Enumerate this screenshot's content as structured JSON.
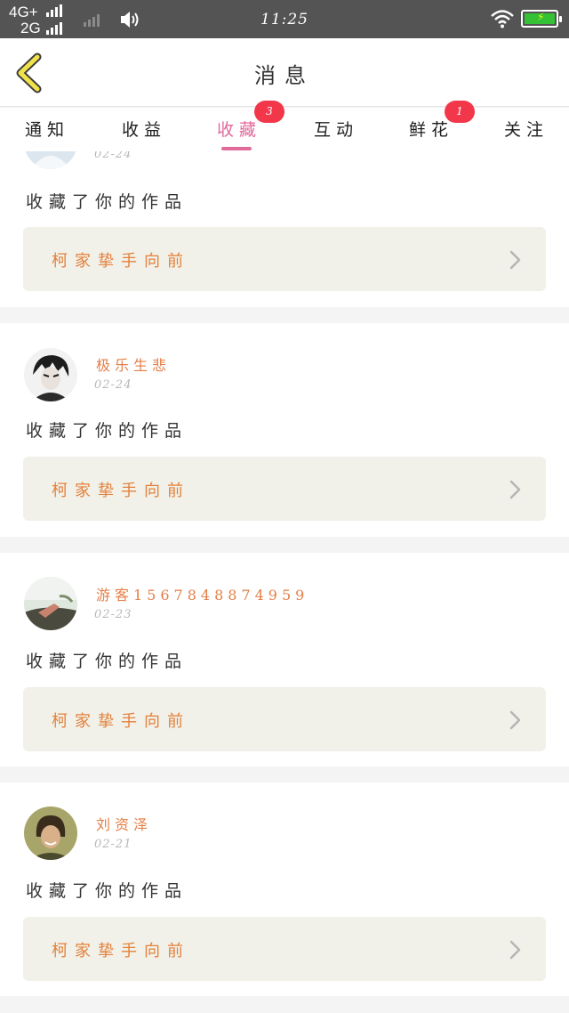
{
  "status_bar": {
    "network_top": "4G+",
    "network_bottom": "2G",
    "time": "11:25"
  },
  "header": {
    "title": "消息",
    "back_icon": "chevron-left-icon"
  },
  "tabs": [
    {
      "label": "通知",
      "badge": ""
    },
    {
      "label": "收益",
      "badge": ""
    },
    {
      "label": "收藏",
      "badge": "3",
      "active": true
    },
    {
      "label": "互动",
      "badge": ""
    },
    {
      "label": "鲜花",
      "badge": "1"
    },
    {
      "label": "关注",
      "badge": ""
    }
  ],
  "items": [
    {
      "user": "",
      "date": "02-24",
      "action": "收藏了你的作品",
      "work_title": "柯家挚手向前"
    },
    {
      "user": "极乐生悲",
      "date": "02-24",
      "action": "收藏了你的作品",
      "work_title": "柯家挚手向前"
    },
    {
      "user": "游客1567848874959",
      "date": "02-23",
      "action": "收藏了你的作品",
      "work_title": "柯家挚手向前"
    },
    {
      "user": "刘资泽",
      "date": "02-21",
      "action": "收藏了你的作品",
      "work_title": "柯家挚手向前"
    }
  ],
  "colors": {
    "accent_pink": "#e06a9a",
    "badge_red": "#f2374b",
    "orange_text": "#e57e46",
    "back_arrow": "#f0e24a"
  }
}
